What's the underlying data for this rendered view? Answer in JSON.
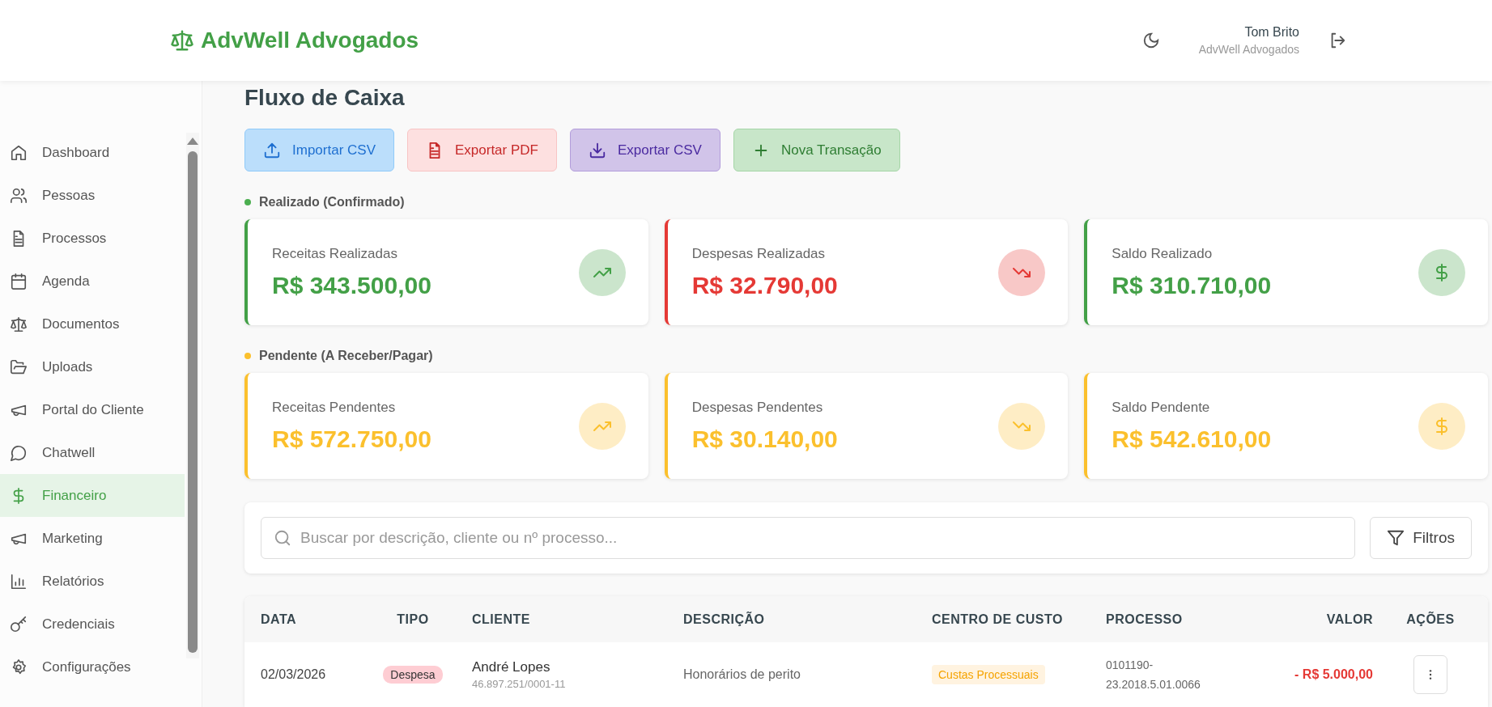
{
  "header": {
    "brand": "AdvWell Advogados",
    "user_name": "Tom Brito",
    "user_org": "AdvWell Advogados"
  },
  "sidebar": {
    "items": [
      {
        "label": "Dashboard",
        "kind": "home",
        "selected": false
      },
      {
        "label": "Pessoas",
        "kind": "users",
        "selected": false
      },
      {
        "label": "Processos",
        "kind": "file",
        "selected": false
      },
      {
        "label": "Agenda",
        "kind": "calendar",
        "selected": false
      },
      {
        "label": "Documentos",
        "kind": "scale",
        "selected": false
      },
      {
        "label": "Uploads",
        "kind": "folder",
        "selected": false
      },
      {
        "label": "Portal do Cliente",
        "kind": "megaphone",
        "selected": false
      },
      {
        "label": "Chatwell",
        "kind": "chat",
        "selected": false
      },
      {
        "label": "Financeiro",
        "kind": "dollar",
        "selected": true
      },
      {
        "label": "Marketing",
        "kind": "megaphone",
        "selected": false
      },
      {
        "label": "Relatórios",
        "kind": "chart",
        "selected": false
      },
      {
        "label": "Credenciais",
        "kind": "key",
        "selected": false
      },
      {
        "label": "Configurações",
        "kind": "gear",
        "selected": false
      }
    ]
  },
  "page": {
    "title": "Fluxo de Caixa"
  },
  "actions": [
    {
      "label": "Importar CSV",
      "kind": "import"
    },
    {
      "label": "Exportar PDF",
      "kind": "pdf"
    },
    {
      "label": "Exportar CSV",
      "kind": "export"
    },
    {
      "label": "Nova Transação",
      "kind": "add"
    }
  ],
  "sections": [
    {
      "label": "Realizado (Confirmado)",
      "color": "#4caf50",
      "cards": [
        {
          "label": "Receitas Realizadas",
          "value": "R$ 343.500,00",
          "kind": "up",
          "color": "#43a047"
        },
        {
          "label": "Despesas Realizadas",
          "value": "R$ 32.790,00",
          "kind": "down",
          "color": "#e53935"
        },
        {
          "label": "Saldo Realizado",
          "value": "R$ 310.710,00",
          "kind": "dollar",
          "color": "#43a047"
        }
      ]
    },
    {
      "label": "Pendente (A Receber/Pagar)",
      "color": "#fbc02d",
      "cards": [
        {
          "label": "Receitas Pendentes",
          "value": "R$ 572.750,00",
          "kind": "up",
          "color": "#fbc02d"
        },
        {
          "label": "Despesas Pendentes",
          "value": "R$ 30.140,00",
          "kind": "down",
          "color": "#fbc02d"
        },
        {
          "label": "Saldo Pendente",
          "value": "R$ 542.610,00",
          "kind": "dollar",
          "color": "#fbc02d"
        }
      ]
    }
  ],
  "search": {
    "placeholder": "Buscar por descrição, cliente ou nº processo..."
  },
  "filter_button": "Filtros",
  "table": {
    "columns": [
      "DATA",
      "TIPO",
      "CLIENTE",
      "DESCRIÇÃO",
      "CENTRO DE CUSTO",
      "PROCESSO",
      "VALOR",
      "AÇÕES"
    ],
    "rows": [
      {
        "date": "02/03/2026",
        "type": "Despesa",
        "kind": "expense",
        "client": "André Lopes",
        "client_doc": "46.897.251/0001-11",
        "description": "Honorários de perito",
        "cost_center": "Custas Processuais",
        "process": "0101190-23.2018.5.01.0066",
        "amount": "- R$ 5.000,00"
      }
    ]
  }
}
